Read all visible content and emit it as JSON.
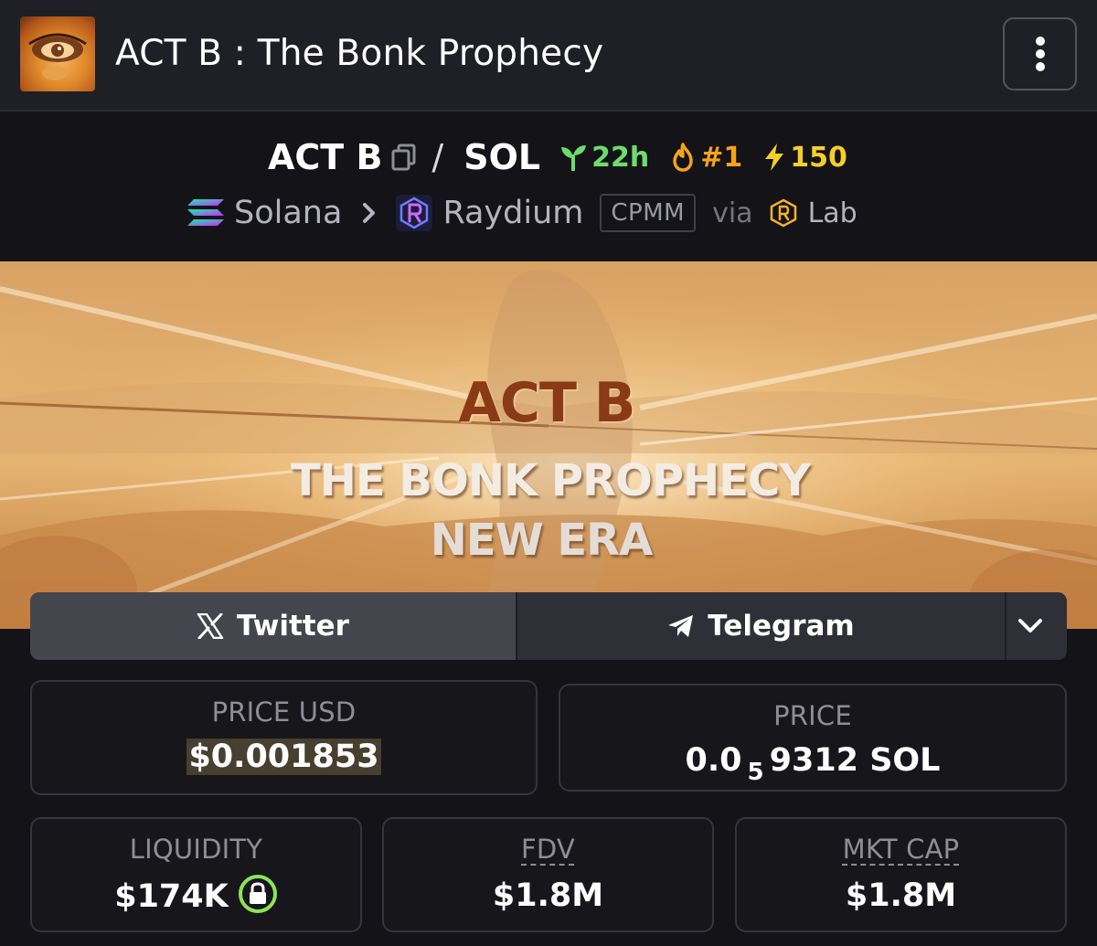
{
  "header": {
    "title": "ACT B : The Bonk Prophecy",
    "avatar_icon": "token-avatar",
    "menu_icon": "kebab-menu-icon"
  },
  "pair": {
    "base": "ACT B",
    "separator": "/",
    "quote": "SOL",
    "age": "22h",
    "rank": "#1",
    "boosts": "150",
    "colors": {
      "age": "#6ddc6d",
      "rank": "#f6a21b",
      "boost": "#f6cd2b"
    }
  },
  "route": {
    "chain": "Solana",
    "dex": "Raydium",
    "pool_type": "CPMM",
    "via": "via",
    "launchpad": "Lab"
  },
  "banner": {
    "title": "ACT B",
    "subtitle": "THE BONK PROPHECY",
    "tagline": "NEW ERA"
  },
  "socials": {
    "twitter": "Twitter",
    "telegram": "Telegram"
  },
  "stats": {
    "price_usd_label": "PRICE USD",
    "price_usd": "$0.001853",
    "price_label": "PRICE",
    "price_sol_prefix": "0.0",
    "price_sol_zeros": "5",
    "price_sol_rest": "9312 SOL",
    "liquidity_label": "LIQUIDITY",
    "liquidity": "$174K",
    "fdv_label": "FDV",
    "fdv": "$1.8M",
    "mcap_label": "MKT CAP",
    "mcap": "$1.8M"
  }
}
